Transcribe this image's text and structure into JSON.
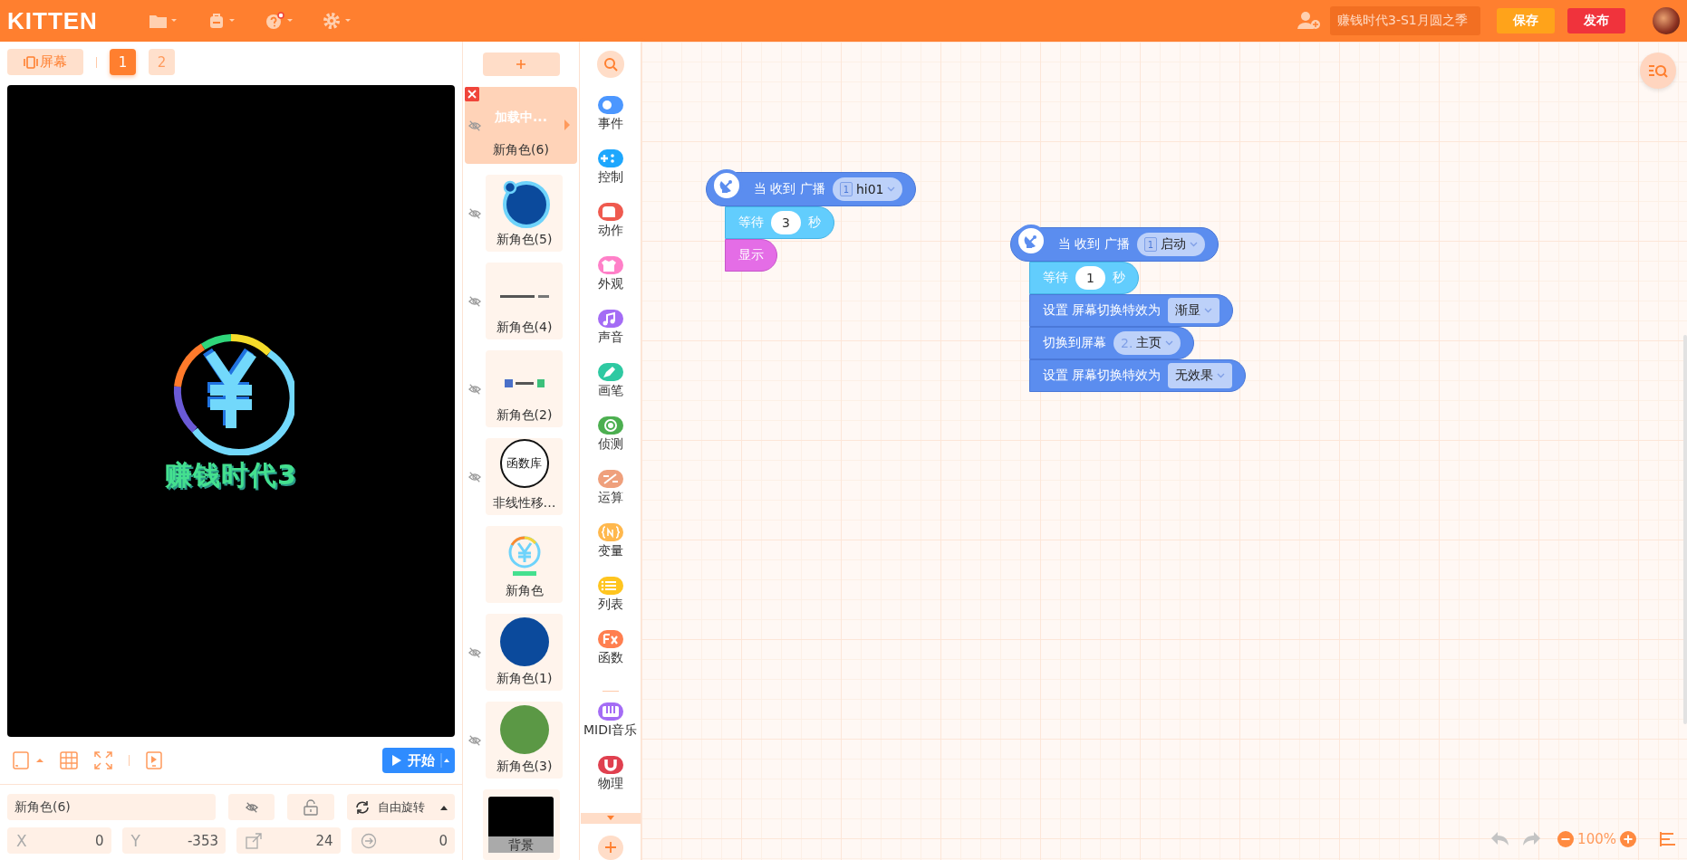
{
  "app": {
    "logo": "KITTEN"
  },
  "toolbar": {
    "project_title": "赚钱时代3-S1月圆之季",
    "save": "保存",
    "publish": "发布"
  },
  "screens": {
    "label": "屏幕",
    "pages": [
      {
        "label": "1",
        "selected": true
      },
      {
        "label": "2",
        "selected": false
      }
    ]
  },
  "stage": {
    "caption": "赚钱时代3",
    "start": "开始"
  },
  "sprite_props": {
    "name": "新角色(6)",
    "hidden": true,
    "locked": false,
    "rotation_mode": "自由旋转",
    "fields": [
      {
        "kind": "x",
        "label": "X",
        "value": "0"
      },
      {
        "kind": "y",
        "label": "Y",
        "value": "-353"
      },
      {
        "kind": "size",
        "value": "24"
      },
      {
        "kind": "direction",
        "value": "0"
      }
    ]
  },
  "sprites": [
    {
      "name": "新角色(6)",
      "selected": true,
      "hidden": true,
      "kind": "loading",
      "thumb_text": "加载中..."
    },
    {
      "name": "新角色(5)",
      "selected": false,
      "hidden": true,
      "kind": "ring"
    },
    {
      "name": "新角色(4)",
      "selected": false,
      "hidden": true,
      "kind": "lines"
    },
    {
      "name": "新角色(2)",
      "selected": false,
      "hidden": true,
      "kind": "icons"
    },
    {
      "name": "非线性移…",
      "selected": false,
      "hidden": true,
      "kind": "label",
      "thumb_text": "函数库"
    },
    {
      "name": "新角色",
      "selected": false,
      "hidden": false,
      "kind": "logo"
    },
    {
      "name": "新角色(1)",
      "selected": false,
      "hidden": true,
      "kind": "dot",
      "color": "#0b4a9c"
    },
    {
      "name": "新角色(3)",
      "selected": false,
      "hidden": true,
      "kind": "dot",
      "color": "#5b9845"
    }
  ],
  "background": {
    "label": "背景"
  },
  "categories": [
    {
      "label": "事件",
      "color": "#4c97ff"
    },
    {
      "label": "控制",
      "color": "#1ea7fd"
    },
    {
      "label": "动作",
      "color": "#ef5a4f"
    },
    {
      "label": "外观",
      "color": "#ff80c8"
    },
    {
      "label": "声音",
      "color": "#a46cf5"
    },
    {
      "label": "画笔",
      "color": "#2ec9a2"
    },
    {
      "label": "侦测",
      "color": "#4caf50"
    },
    {
      "label": "运算",
      "color": "#efa07c"
    },
    {
      "label": "变量",
      "color": "#ffb84d"
    },
    {
      "label": "列表",
      "color": "#ffc51f"
    },
    {
      "label": "函数",
      "color": "#ff7f50"
    },
    {
      "label": "MIDI音乐",
      "color": "#a46cf5"
    },
    {
      "label": "物理",
      "color": "#e0404f"
    }
  ],
  "scripts": [
    {
      "blocks": [
        {
          "kind": "hat",
          "parts": [
            {
              "kind": "text",
              "text": "当 收到 广播"
            },
            {
              "kind": "dropdown",
              "badge": "1",
              "text": "hi01"
            }
          ]
        },
        {
          "kind": "wait",
          "parts": [
            {
              "kind": "text",
              "text": "等待"
            },
            {
              "kind": "number",
              "text": "3"
            },
            {
              "kind": "text",
              "text": "秒"
            }
          ]
        },
        {
          "kind": "looks",
          "parts": [
            {
              "kind": "text",
              "text": "显示"
            }
          ]
        }
      ]
    },
    {
      "blocks": [
        {
          "kind": "hat",
          "parts": [
            {
              "kind": "text",
              "text": "当 收到 广播"
            },
            {
              "kind": "dropdown",
              "badge": "1",
              "text": "启动"
            }
          ]
        },
        {
          "kind": "wait",
          "parts": [
            {
              "kind": "text",
              "text": "等待"
            },
            {
              "kind": "number",
              "text": "1"
            },
            {
              "kind": "text",
              "text": "秒"
            }
          ]
        },
        {
          "kind": "screen",
          "parts": [
            {
              "kind": "text",
              "text": "设置 屏幕切换特效为"
            },
            {
              "kind": "menu",
              "text": "渐显"
            }
          ]
        },
        {
          "kind": "screen",
          "parts": [
            {
              "kind": "text",
              "text": "切换到屏幕"
            },
            {
              "kind": "dropdown",
              "prefix": "2.",
              "text": "主页"
            }
          ]
        },
        {
          "kind": "screen",
          "parts": [
            {
              "kind": "text",
              "text": "设置 屏幕切换特效为"
            },
            {
              "kind": "menu",
              "text": "无效果"
            }
          ]
        }
      ]
    }
  ],
  "zoom": {
    "level_text": "100%",
    "undo": {
      "disabled": true
    },
    "redo": {
      "disabled": true
    }
  }
}
